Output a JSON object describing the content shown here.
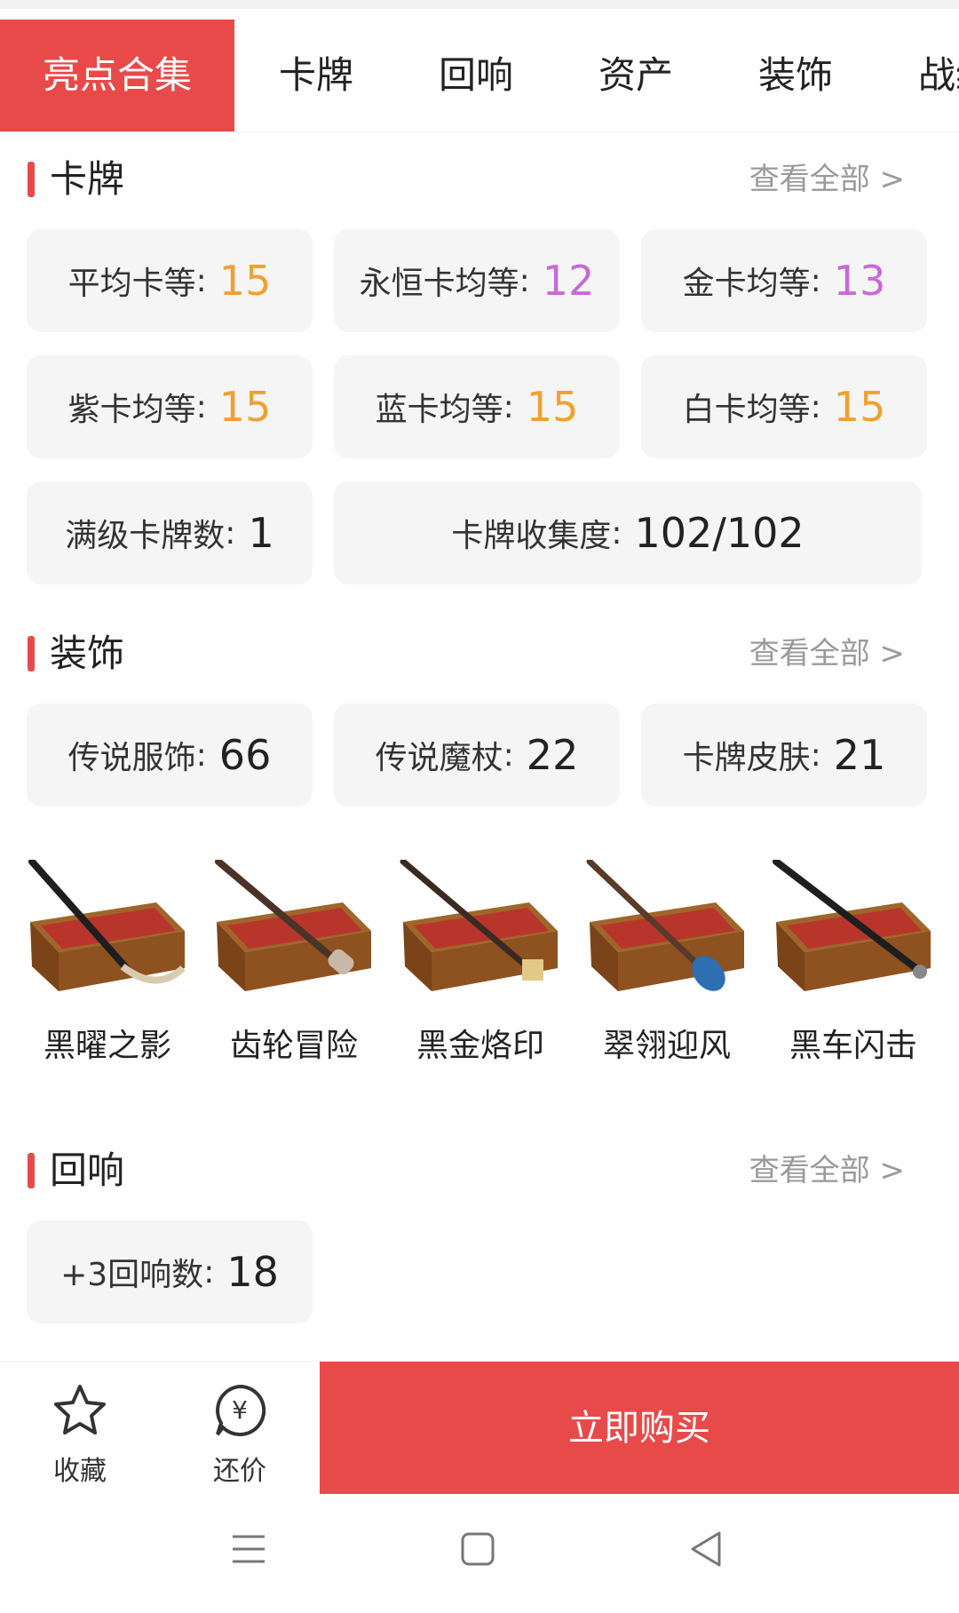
{
  "colors": {
    "accent": "#e84a4a",
    "orange": "#f0a030",
    "purple": "#c66ad6"
  },
  "tabs": [
    {
      "label": "亮点合集",
      "active": true
    },
    {
      "label": "卡牌"
    },
    {
      "label": "回响"
    },
    {
      "label": "资产"
    },
    {
      "label": "装饰"
    },
    {
      "label": "战绩"
    }
  ],
  "cards_section": {
    "title": "卡牌",
    "view_all": "查看全部 >",
    "stats": [
      {
        "label": "平均卡等",
        "value": "15",
        "color": "orange"
      },
      {
        "label": "永恒卡均等",
        "value": "12",
        "color": "purple"
      },
      {
        "label": "金卡均等",
        "value": "13",
        "color": "purple"
      },
      {
        "label": "紫卡均等",
        "value": "15",
        "color": "orange"
      },
      {
        "label": "蓝卡均等",
        "value": "15",
        "color": "orange"
      },
      {
        "label": "白卡均等",
        "value": "15",
        "color": "orange"
      },
      {
        "label": "满级卡牌数",
        "value": "1"
      },
      {
        "label": "卡牌收集度",
        "value": "102/102"
      }
    ]
  },
  "decor_section": {
    "title": "装饰",
    "view_all": "查看全部 >",
    "stats": [
      {
        "label": "传说服饰",
        "value": "66"
      },
      {
        "label": "传说魔杖",
        "value": "22"
      },
      {
        "label": "卡牌皮肤",
        "value": "21"
      }
    ],
    "wands": [
      {
        "name": "黑曜之影",
        "icon": "wand-box-icon"
      },
      {
        "name": "齿轮冒险",
        "icon": "wand-box-icon"
      },
      {
        "name": "黑金烙印",
        "icon": "wand-box-icon"
      },
      {
        "name": "翠翎迎风",
        "icon": "wand-box-icon"
      },
      {
        "name": "黑车闪击",
        "icon": "wand-box-icon"
      }
    ]
  },
  "echo_section": {
    "title": "回响",
    "view_all": "查看全部 >",
    "stats": [
      {
        "label": "+3回响数",
        "value": "18"
      }
    ]
  },
  "bottom_bar": {
    "favorite_label": "收藏",
    "bargain_label": "还价",
    "buy_label": "立即购买"
  }
}
